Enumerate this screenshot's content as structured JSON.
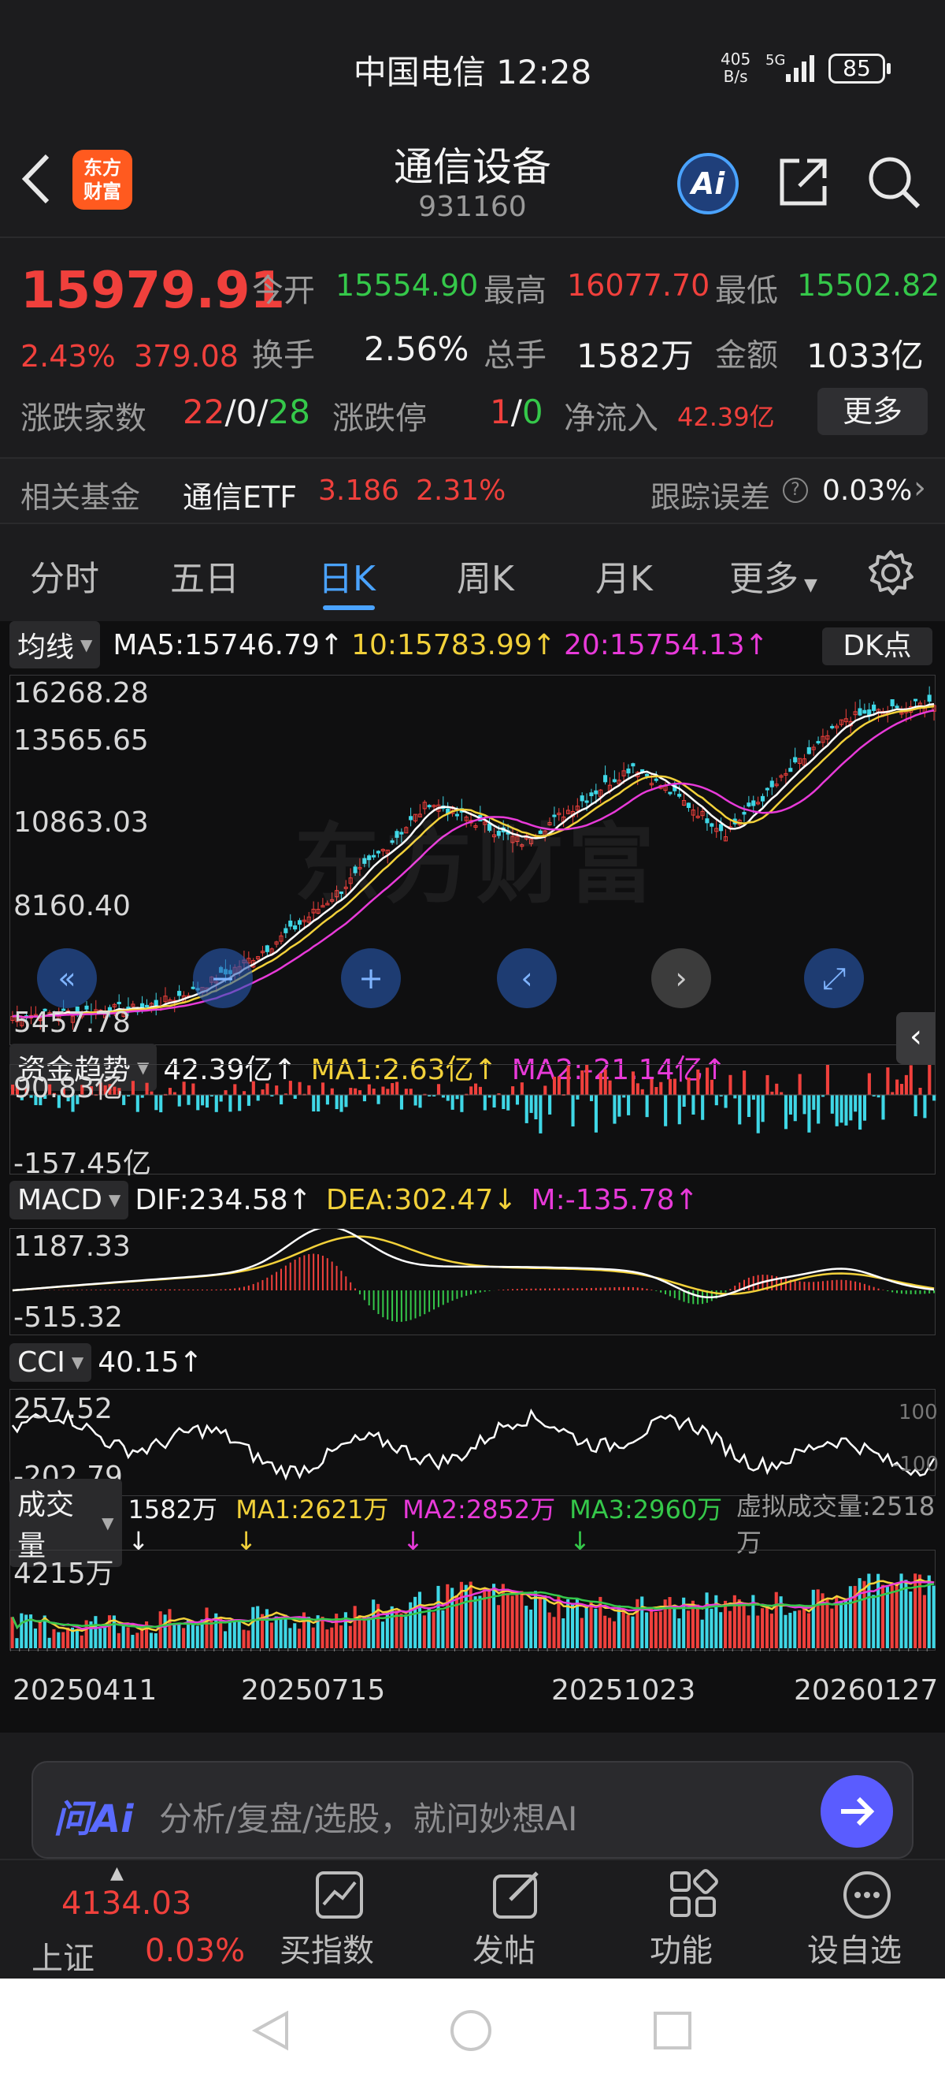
{
  "status": {
    "carrier": "中国电信",
    "time": "12:28",
    "net_speed_top": "405",
    "net_speed_bottom": "B/s",
    "signal": "5G",
    "battery": "85"
  },
  "header": {
    "logo_line1": "东方",
    "logo_line2": "财富",
    "title": "通信设备",
    "code": "931160",
    "ai_label": "Ai"
  },
  "quote": {
    "price": "15979.91",
    "change_pct": "2.43%",
    "change_abs": "379.08",
    "open_label": "今开",
    "open": "15554.90",
    "high_label": "最高",
    "high": "16077.70",
    "low_label": "最低",
    "low": "15502.82",
    "turnover_label": "换手",
    "turnover": "2.56%",
    "volume_label": "总手",
    "volume": "1582万",
    "amount_label": "金额",
    "amount": "1033亿",
    "updown_label": "涨跌家数",
    "up": "22",
    "flat": "0",
    "down": "28",
    "limit_label": "涨跌停",
    "limit_up": "1",
    "limit_down": "0",
    "inflow_label": "净流入",
    "inflow": "42.39亿",
    "more_button": "更多"
  },
  "fund": {
    "label": "相关基金",
    "name": "通信ETF",
    "price": "3.186",
    "pct": "2.31%",
    "tracking_label": "跟踪误差",
    "tracking_value": "0.03%"
  },
  "tabs": [
    "分时",
    "五日",
    "日K",
    "周K",
    "月K",
    "更多"
  ],
  "active_tab": "日K",
  "kline": {
    "indicator": "均线",
    "ma5": "MA5:15746.79↑",
    "ma10": "10:15783.99↑",
    "ma20": "20:15754.13↑",
    "dk_button": "DK点",
    "y_labels": [
      "16268.28",
      "13565.65",
      "10863.03",
      "8160.40",
      "5457.78"
    ],
    "watermark": "东方财富"
  },
  "fundflow": {
    "indicator": "资金趋势",
    "value": "42.39亿↑",
    "ma1": "MA1:2.63亿↑",
    "ma2": "MA2:-21.14亿↑",
    "top": "90.83亿",
    "bottom": "-157.45亿"
  },
  "macd": {
    "indicator": "MACD",
    "dif": "DIF:234.58↑",
    "dea": "DEA:302.47↓",
    "m": "M:-135.78↑",
    "top": "1187.33",
    "bottom": "-515.32"
  },
  "cci": {
    "indicator": "CCI",
    "value": "40.15↑",
    "top": "257.52",
    "bottom": "-202.79",
    "right_top": "100",
    "right_bottom": "-100"
  },
  "vol": {
    "indicator": "成交量",
    "value": "1582万↓",
    "ma1": "MA1:2621万↓",
    "ma2": "MA2:2852万↓",
    "ma3": "MA3:2960万↓",
    "virtual": "虚拟成交量:2518万",
    "top": "4215万",
    "dates": [
      "20250411",
      "20250715",
      "20251023",
      "20260127"
    ]
  },
  "ai": {
    "logo": "问Ai",
    "placeholder": "分析/复盘/选股，就问妙想AI"
  },
  "nav": {
    "index_value": "4134.03",
    "index_name": "上证",
    "index_pct": "0.03%",
    "items": [
      "买指数",
      "发帖",
      "功能",
      "设自选"
    ]
  },
  "colors": {
    "up": "#f0403c",
    "down": "#35c84a",
    "accent": "#4aa3ff",
    "ma_yellow": "#f2d13a",
    "ma_magenta": "#e83ad9",
    "cyan": "#3fd7e6"
  }
}
